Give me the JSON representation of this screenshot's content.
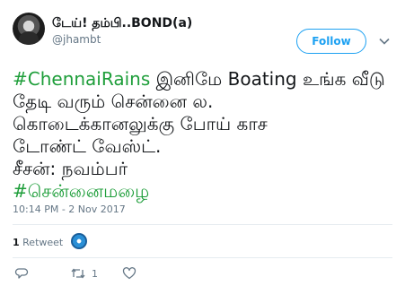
{
  "author": {
    "display_name": "டேய்! தம்பி..BOND(a)",
    "handle": "@jhambt"
  },
  "follow_label": "Follow",
  "tweet": {
    "hashtag_1": "#ChennaiRains",
    "line1_rest": " இனிமே Boating உங்க வீடு",
    "line2": "தேடி வரும் சென்னை ல.",
    "line3": "கொடைக்கானலுக்கு போய் காச",
    "line4": "டோண்ட் வேஸ்ட்.",
    "line5": "சீசன்: நவம்பர்",
    "hashtag_2": "#சென்னைமழை",
    "hashtag_color": "#1e9e3a"
  },
  "timestamp": "10:14 PM - 2 Nov 2017",
  "stats": {
    "retweet_count": "1",
    "retweet_label": "Retweet"
  },
  "actions": {
    "retweet_count": "1"
  },
  "colors": {
    "accent": "#1da1f2",
    "muted": "#657786"
  }
}
